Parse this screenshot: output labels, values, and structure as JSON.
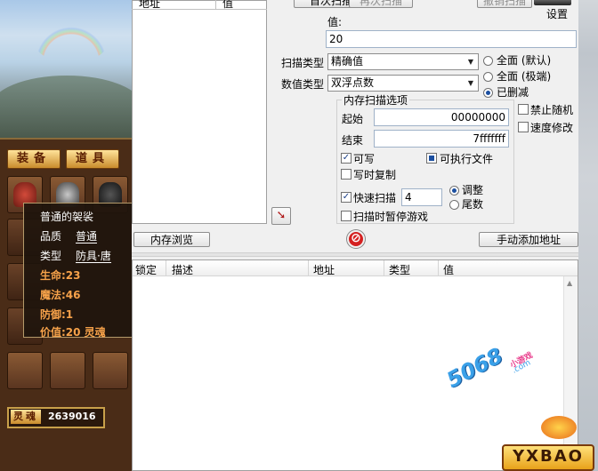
{
  "game": {
    "btn_equip": "装备",
    "btn_item": "道具",
    "tooltip": {
      "name": "普通的袈裟",
      "quality_label": "品质",
      "quality_value": "普通",
      "type_label": "类型",
      "type_value": "防具·唐",
      "hp": "生命:23",
      "mp": "魔法:46",
      "def": "防御:1",
      "value": "价值:20 灵魂"
    },
    "soul_label": "灵魂",
    "soul_value": "2639016"
  },
  "ce": {
    "top_list_headers": [
      "地址",
      "值"
    ],
    "btn_first_scan": "首次扫描",
    "btn_next_scan": "再次扫描",
    "btn_undo_scan": "撤销扫描",
    "settings": "设置",
    "value_label": "值:",
    "value_input": "20",
    "scan_type_label": "扫描类型",
    "scan_type_value": "精确值",
    "value_type_label": "数值类型",
    "value_type_value": "双浮点数",
    "radio_full_default": "全面 (默认)",
    "radio_full_extreme": "全面 (极端)",
    "radio_trimmed": "已删减",
    "mem_options_title": "内存扫描选项",
    "start_label": "起始",
    "start_value": "00000000",
    "stop_label": "结束",
    "stop_value": "7fffffff",
    "chk_writable": "可写",
    "chk_executable": "可执行文件",
    "chk_copy_on_write": "写时复制",
    "chk_fast_scan": "快速扫描",
    "fast_scan_value": "4",
    "radio_alignment": "调整",
    "radio_last_digits": "尾数",
    "chk_pause": "扫描时暂停游戏",
    "chk_random": "禁止随机",
    "chk_speedhack": "速度修改",
    "btn_memory_view": "内存浏览",
    "btn_add_manual": "手动添加地址",
    "table_headers": [
      "锁定",
      "描述",
      "地址",
      "类型",
      "值"
    ]
  },
  "watermark": {
    "site": "5068",
    "brand_small": "小游戏",
    "domain": ".com",
    "logo_text": "YXBAO"
  }
}
